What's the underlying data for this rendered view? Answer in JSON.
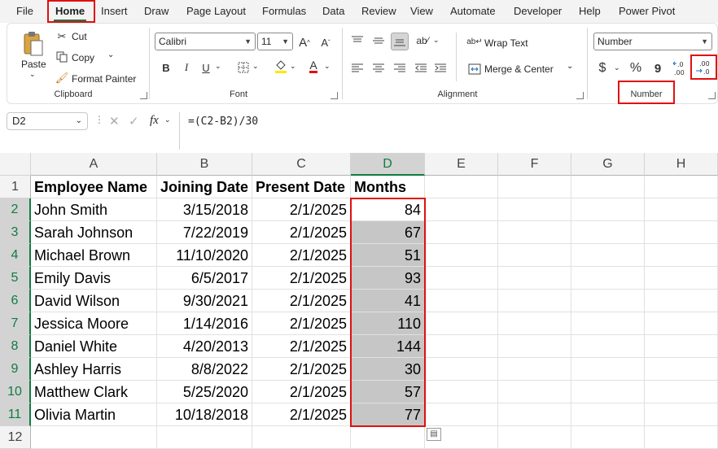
{
  "menu": {
    "items": [
      "File",
      "Home",
      "Insert",
      "Draw",
      "Page Layout",
      "Formulas",
      "Data",
      "Review",
      "View",
      "Automate",
      "Developer",
      "Help",
      "Power Pivot"
    ],
    "active": "Home"
  },
  "ribbon": {
    "clipboard": {
      "paste": "Paste",
      "cut": "Cut",
      "copy": "Copy",
      "format_painter": "Format Painter",
      "label": "Clipboard"
    },
    "font": {
      "font_name": "Calibri",
      "font_size": "11",
      "bold": "B",
      "italic": "I",
      "underline": "U",
      "label": "Font"
    },
    "alignment": {
      "wrap_text": "Wrap Text",
      "merge_center": "Merge & Center",
      "label": "Alignment"
    },
    "number": {
      "format": "Number",
      "currency": "$",
      "percent": "%",
      "comma": "9",
      "label": "Number"
    }
  },
  "formula_bar": {
    "name_box": "D2",
    "fx": "fx",
    "formula": "=(C2-B2)/30"
  },
  "sheet": {
    "columns": [
      "A",
      "B",
      "C",
      "D",
      "E",
      "F",
      "G",
      "H"
    ],
    "rows": [
      "1",
      "2",
      "3",
      "4",
      "5",
      "6",
      "7",
      "8",
      "9",
      "10",
      "11",
      "12"
    ],
    "headers": [
      "Employee Name",
      "Joining Date",
      "Present Date",
      "Months"
    ],
    "data": [
      [
        "John Smith",
        "3/15/2018",
        "2/1/2025",
        "84"
      ],
      [
        "Sarah Johnson",
        "7/22/2019",
        "2/1/2025",
        "67"
      ],
      [
        "Michael Brown",
        "11/10/2020",
        "2/1/2025",
        "51"
      ],
      [
        "Emily Davis",
        "6/5/2017",
        "2/1/2025",
        "93"
      ],
      [
        "David Wilson",
        "9/30/2021",
        "2/1/2025",
        "41"
      ],
      [
        "Jessica Moore",
        "1/14/2016",
        "2/1/2025",
        "110"
      ],
      [
        "Daniel White",
        "4/20/2013",
        "2/1/2025",
        "144"
      ],
      [
        "Ashley Harris",
        "8/8/2022",
        "2/1/2025",
        "30"
      ],
      [
        "Matthew Clark",
        "5/25/2020",
        "2/1/2025",
        "57"
      ],
      [
        "Olivia Martin",
        "10/18/2018",
        "2/1/2025",
        "77"
      ]
    ]
  },
  "colors": {
    "accent_green": "#107c41",
    "highlight_red": "#e01010",
    "selection_gray": "#c6c6c6"
  }
}
